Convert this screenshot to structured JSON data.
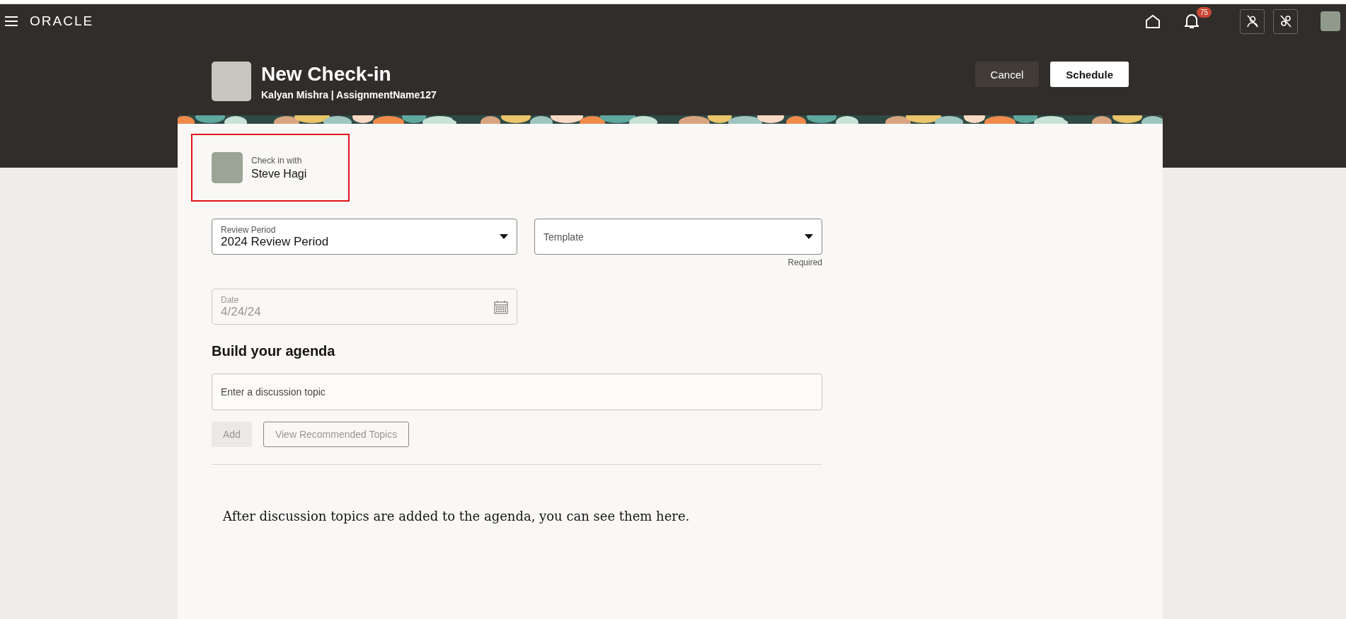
{
  "topbar": {
    "logo": "ORACLE",
    "notifications_count": "75"
  },
  "header": {
    "title": "New Check-in",
    "subtitle": "Kalyan Mishra | AssignmentName127",
    "buttons": [
      {
        "label": "Cancel",
        "kind": "secondary"
      },
      {
        "label": "Schedule",
        "kind": "primary"
      }
    ]
  },
  "check_in_with": {
    "label": "Check in with",
    "name": "Steve Hagi",
    "highlighted": true
  },
  "fields": [
    {
      "label": "Review Period",
      "value": "2024 Review Period",
      "kind": "select",
      "disabled": false
    },
    {
      "label": "Template",
      "kind": "select",
      "disabled": false,
      "helper": "Required"
    },
    {
      "label": "Date",
      "value": "4/24/24",
      "kind": "date",
      "disabled": true
    }
  ],
  "agenda": {
    "title": "Build your agenda",
    "topic_field": {
      "placeholder": "Enter a discussion topic"
    },
    "buttons": [
      {
        "label": "Add",
        "kind": "solid",
        "disabled": true
      },
      {
        "label": "View Recommended Topics",
        "kind": "outlined",
        "disabled": true
      }
    ],
    "empty_message": "After discussion topics are added to the agenda, you can see them here."
  }
}
